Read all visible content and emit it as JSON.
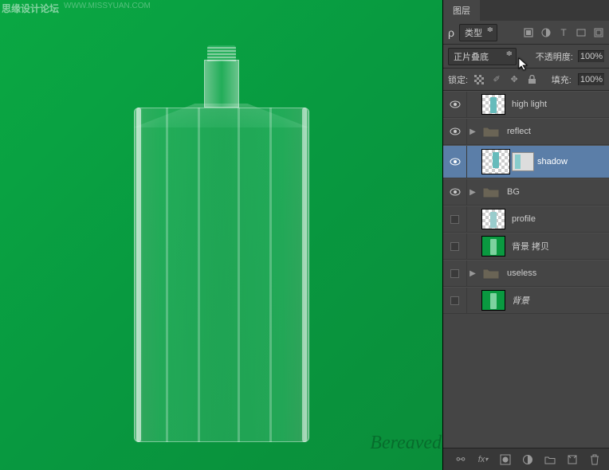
{
  "watermarks": {
    "top_left": "思缘设计论坛",
    "url": "WWW.MISSYUAN.COM",
    "bottom_right": "Bereaved"
  },
  "panel": {
    "tab": "图层",
    "filter_kind": "类型",
    "blend_mode": "正片叠底",
    "opacity_label": "不透明度:",
    "opacity_value": "100%",
    "lock_label": "锁定:",
    "fill_label": "填充:",
    "fill_value": "100%"
  },
  "layers": [
    {
      "name": "high light",
      "visible": true,
      "type": "layer",
      "thumb": "checker",
      "selected": false
    },
    {
      "name": "reflect",
      "visible": true,
      "type": "group",
      "selected": false
    },
    {
      "name": "shadow",
      "visible": true,
      "type": "layer-mask",
      "thumb": "checker",
      "selected": true
    },
    {
      "name": "BG",
      "visible": true,
      "type": "group",
      "selected": false
    },
    {
      "name": "profile",
      "visible": false,
      "type": "layer",
      "thumb": "checker",
      "selected": false
    },
    {
      "name": "背景 拷贝",
      "visible": false,
      "type": "layer",
      "thumb": "green",
      "selected": false
    },
    {
      "name": "useless",
      "visible": false,
      "type": "group",
      "selected": false
    },
    {
      "name": "背景",
      "visible": false,
      "type": "layer",
      "thumb": "green",
      "selected": false,
      "italic": true
    }
  ],
  "bottom_icons": [
    "link",
    "fx",
    "mask",
    "adjust",
    "group",
    "new",
    "trash"
  ]
}
